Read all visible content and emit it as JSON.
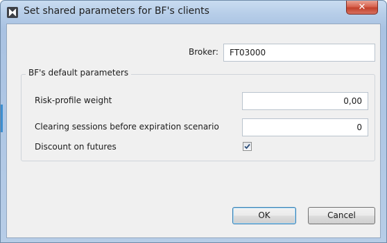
{
  "window": {
    "title": "Set shared parameters for BF's clients",
    "close_glyph": "✕"
  },
  "broker": {
    "label": "Broker:",
    "value": "FT03000"
  },
  "group": {
    "title": "BF's default parameters",
    "risk_profile_weight": {
      "label": "Risk-profile weight",
      "value": "0,00"
    },
    "clearing_sessions": {
      "label": "Clearing sessions before expiration scenario",
      "value": "0"
    },
    "discount_on_futures": {
      "label": "Discount on futures",
      "checked": true
    }
  },
  "buttons": {
    "ok": "OK",
    "cancel": "Cancel"
  },
  "icons": {
    "app": "app-logo-icon",
    "close": "close-icon",
    "check": "checkmark-icon"
  },
  "colors": {
    "titlebar": "#b6cde8",
    "close_button": "#c2412b",
    "dialog_body": "#f0f0f0",
    "accent": "#3d8fd0"
  }
}
